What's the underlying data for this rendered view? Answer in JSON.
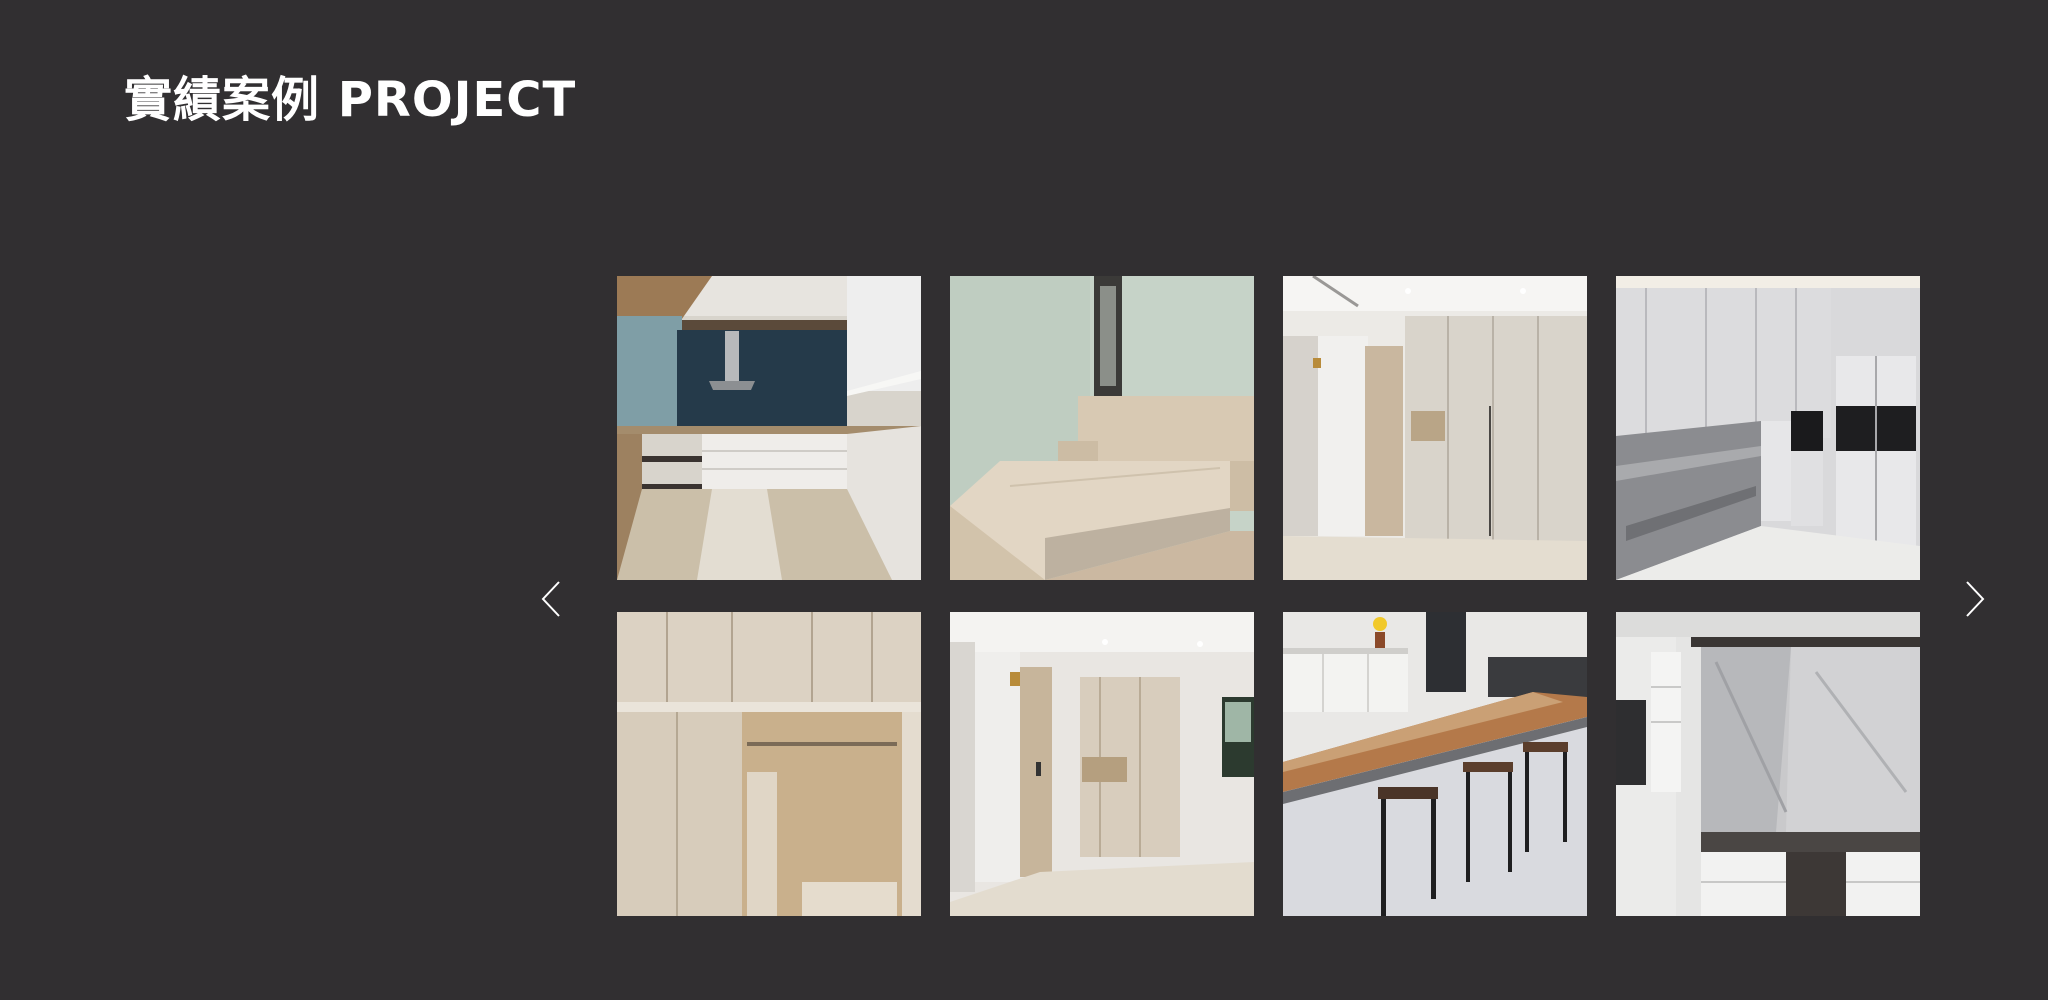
{
  "page": {
    "title": "實績案例 PROJECT",
    "background": "#312f31"
  },
  "carousel": {
    "prev_icon": "chevron-left-icon",
    "next_icon": "chevron-right-icon",
    "arrow_color": "#ffffff"
  },
  "projects": [
    {
      "image": "kitchen-project-photo"
    },
    {
      "image": "bedroom-project-photo"
    },
    {
      "image": "wardrobe-project-photo"
    },
    {
      "image": "marble-cabinet-project-photo"
    },
    {
      "image": "wood-closet-project-photo"
    },
    {
      "image": "entryway-project-photo"
    },
    {
      "image": "bar-counter-project-photo"
    },
    {
      "image": "tv-wall-project-photo"
    }
  ]
}
